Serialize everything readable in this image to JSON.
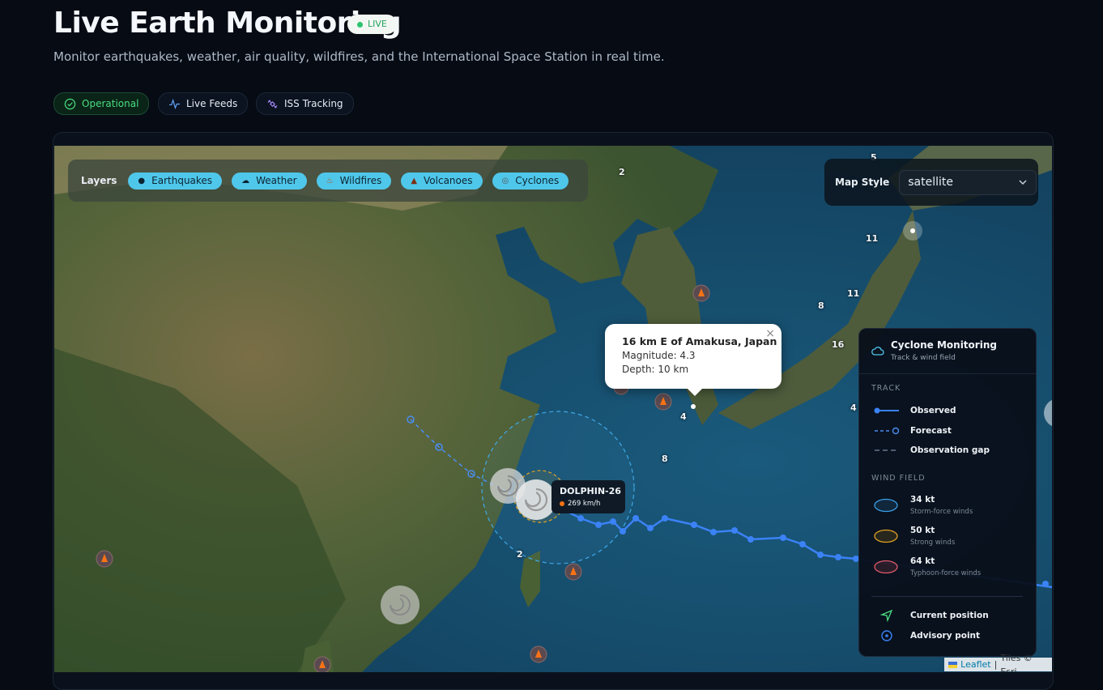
{
  "header": {
    "title": "Live Earth Monitoring",
    "live_badge": "LIVE",
    "subtitle": "Monitor earthquakes, weather, air quality, wildfires, and the International Space Station in real time."
  },
  "status_pills": [
    {
      "label": "Operational",
      "icon": "check-circle-icon"
    },
    {
      "label": "Live Feeds",
      "icon": "pulse-icon"
    },
    {
      "label": "ISS Tracking",
      "icon": "satellite-icon"
    }
  ],
  "layers": {
    "label": "Layers",
    "items": [
      {
        "label": "Earthquakes",
        "icon": "dot-icon"
      },
      {
        "label": "Weather",
        "icon": "cloud-icon"
      },
      {
        "label": "Wildfires",
        "icon": "fire-icon"
      },
      {
        "label": "Volcanoes",
        "icon": "volcano-icon"
      },
      {
        "label": "Cyclones",
        "icon": "cyclone-icon"
      }
    ]
  },
  "map_style": {
    "label": "Map Style",
    "value": "satellite"
  },
  "popup": {
    "title": "16 km E of Amakusa, Japan",
    "magnitude": "Magnitude: 4.3",
    "depth": "Depth: 10 km",
    "close": "×"
  },
  "storm": {
    "name": "DOLPHIN-26",
    "speed": "269 km/h"
  },
  "map_labels": [
    "2",
    "5",
    "11",
    "11",
    "8",
    "16",
    "4",
    "4",
    "8",
    "2"
  ],
  "legend": {
    "title": "Cyclone Monitoring",
    "subtitle": "Track & wind field",
    "track_heading": "TRACK",
    "track_items": [
      "Observed",
      "Forecast",
      "Observation gap"
    ],
    "wind_heading": "WIND FIELD",
    "wind_items": [
      {
        "label": "34 kt",
        "desc": "Storm-force winds",
        "color": "#3b9ee8"
      },
      {
        "label": "50 kt",
        "desc": "Strong winds",
        "color": "#e0a020"
      },
      {
        "label": "64 kt",
        "desc": "Typhoon-force winds",
        "color": "#e05a6a"
      }
    ],
    "markers": [
      "Current position",
      "Advisory point"
    ]
  },
  "attribution": {
    "leaflet": "Leaflet",
    "sep": "|",
    "tiles": "Tiles © Esri"
  },
  "colors": {
    "accent_chip": "#4fc7ea",
    "track": "#3b82f6",
    "operational": "#4ade80"
  }
}
